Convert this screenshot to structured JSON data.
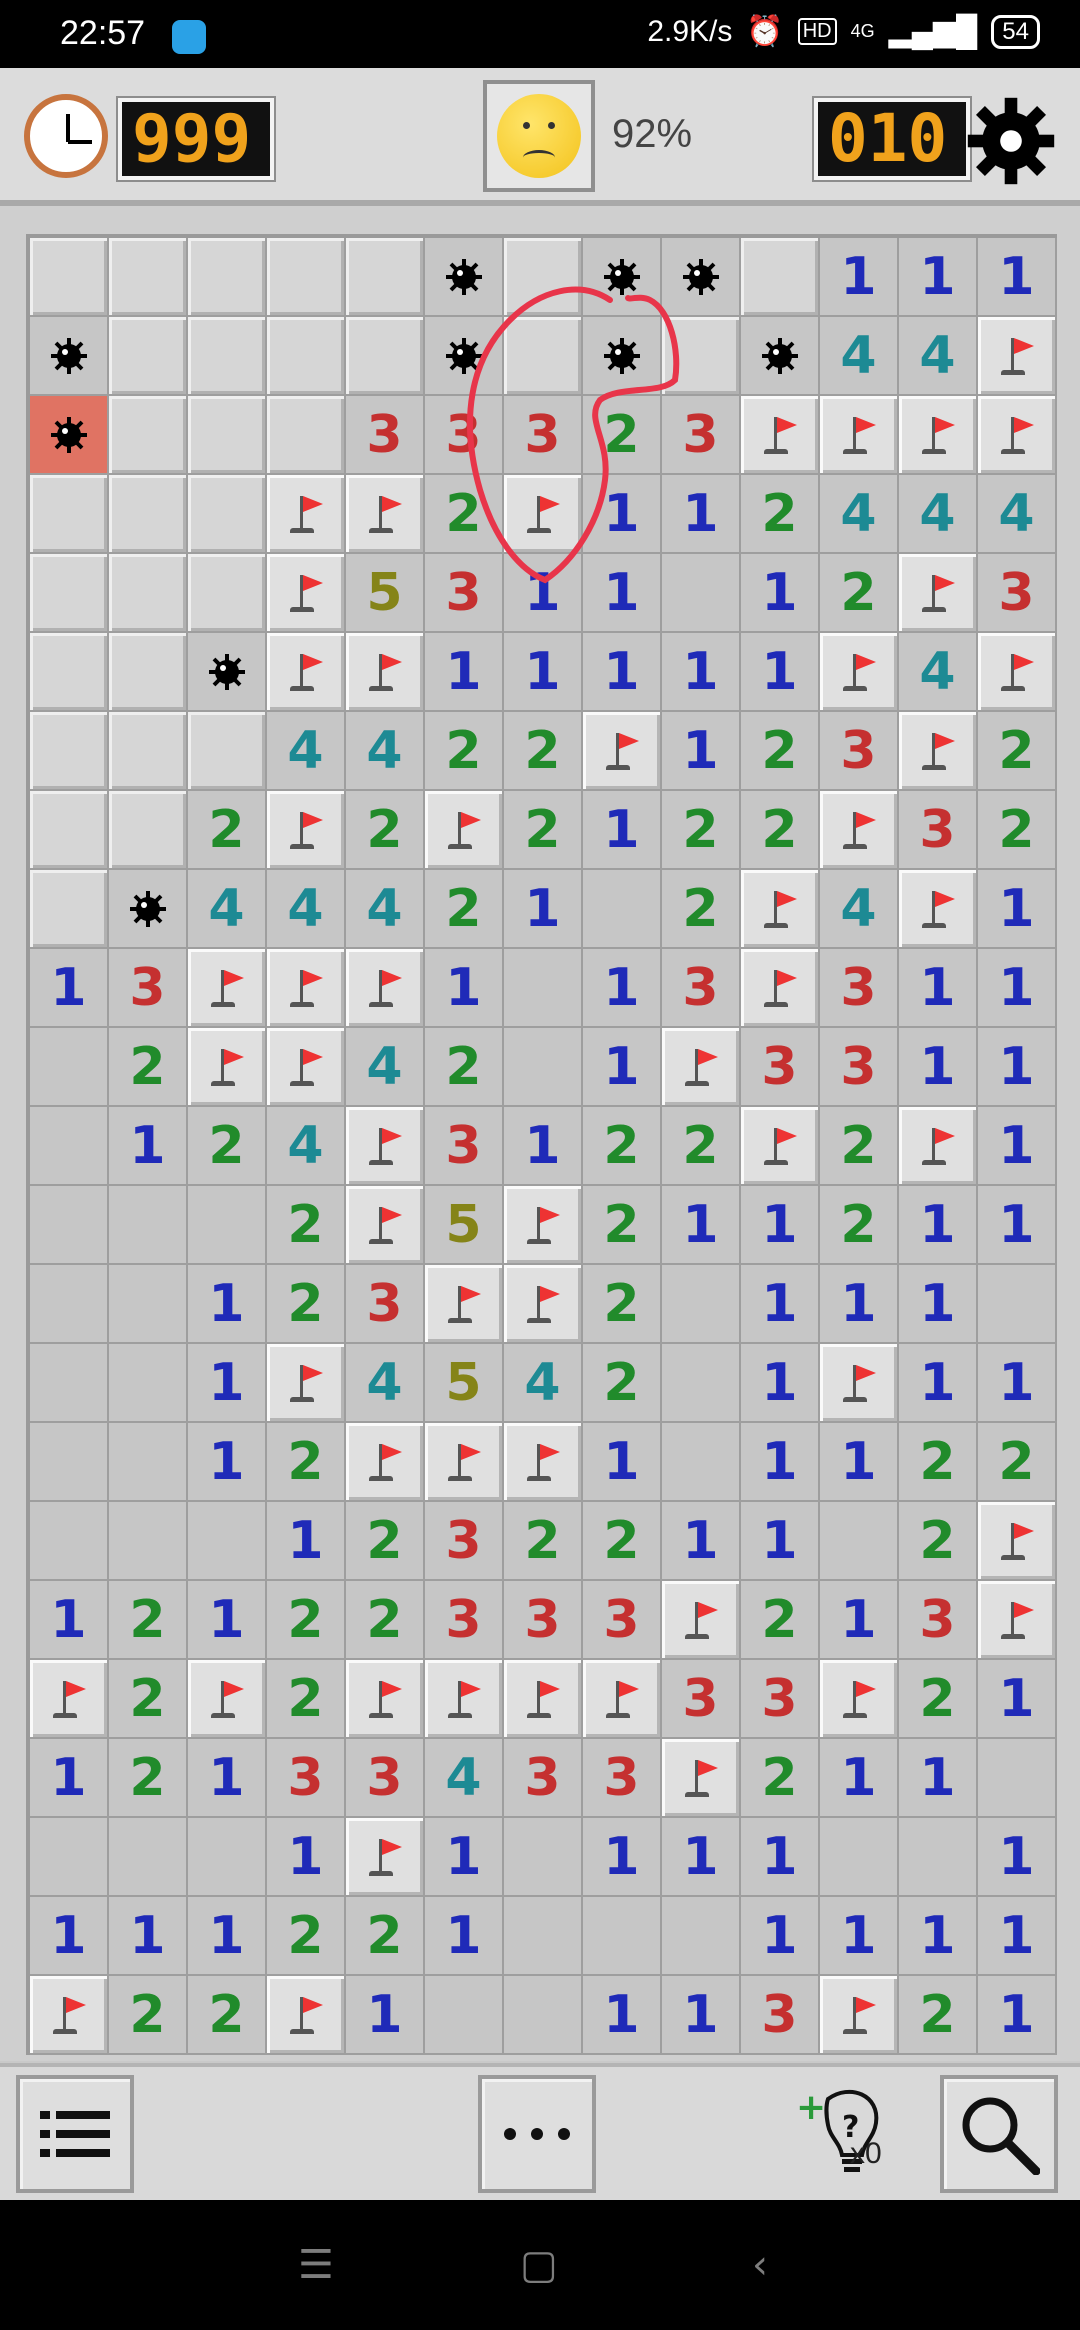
{
  "status": {
    "time": "22:57",
    "net": "2.9K/s",
    "hd": "HD",
    "signal": "4G",
    "battery": "54"
  },
  "header": {
    "timer": "999",
    "progress": "92%",
    "mines_left": "010"
  },
  "board": {
    "legend": "c=covered, f=flag, e=empty revealed, m=mine, b=exploded mine, digit=number",
    "rows": [
      [
        "c",
        "c",
        "c",
        "c",
        "c",
        "m",
        "c",
        "m",
        "m",
        "c",
        "1",
        "1",
        "1"
      ],
      [
        "m",
        "c",
        "c",
        "c",
        "c",
        "m",
        "c",
        "m",
        "c",
        "m",
        "4",
        "4",
        "f"
      ],
      [
        "b",
        "c",
        "c",
        "c",
        "3",
        "3",
        "3",
        "2",
        "3",
        "f",
        "f",
        "f",
        "f"
      ],
      [
        "c",
        "c",
        "c",
        "f",
        "f",
        "2",
        "f",
        "1",
        "1",
        "2",
        "4",
        "4",
        "4"
      ],
      [
        "c",
        "c",
        "c",
        "f",
        "5",
        "3",
        "1",
        "1",
        "e",
        "1",
        "2",
        "f",
        "3"
      ],
      [
        "c",
        "c",
        "m",
        "f",
        "f",
        "1",
        "1",
        "1",
        "1",
        "1",
        "f",
        "4",
        "f"
      ],
      [
        "c",
        "c",
        "c",
        "4",
        "4",
        "2",
        "2",
        "f",
        "1",
        "2",
        "3",
        "f",
        "2"
      ],
      [
        "c",
        "c",
        "2",
        "f",
        "2",
        "f",
        "2",
        "1",
        "2",
        "2",
        "f",
        "3",
        "2"
      ],
      [
        "c",
        "m",
        "4",
        "4",
        "4",
        "2",
        "1",
        "e",
        "2",
        "f",
        "4",
        "f",
        "1"
      ],
      [
        "1",
        "3",
        "f",
        "f",
        "f",
        "1",
        "e",
        "1",
        "3",
        "f",
        "3",
        "1",
        "1"
      ],
      [
        "e",
        "2",
        "f",
        "f",
        "4",
        "2",
        "e",
        "1",
        "f",
        "3",
        "3",
        "1",
        "1"
      ],
      [
        "e",
        "1",
        "2",
        "4",
        "f",
        "3",
        "1",
        "2",
        "2",
        "f",
        "2",
        "f",
        "1"
      ],
      [
        "e",
        "e",
        "e",
        "2",
        "f",
        "5",
        "f",
        "2",
        "1",
        "1",
        "2",
        "1",
        "1"
      ],
      [
        "e",
        "e",
        "1",
        "2",
        "3",
        "f",
        "f",
        "2",
        "e",
        "1",
        "1",
        "1",
        "e"
      ],
      [
        "e",
        "e",
        "1",
        "f",
        "4",
        "5",
        "4",
        "2",
        "e",
        "1",
        "f",
        "1",
        "1"
      ],
      [
        "e",
        "e",
        "1",
        "2",
        "f",
        "f",
        "f",
        "1",
        "e",
        "1",
        "1",
        "2",
        "2"
      ],
      [
        "e",
        "e",
        "e",
        "1",
        "2",
        "3",
        "2",
        "2",
        "1",
        "1",
        "e",
        "2",
        "f"
      ],
      [
        "1",
        "2",
        "1",
        "2",
        "2",
        "3",
        "3",
        "3",
        "f",
        "2",
        "1",
        "3",
        "f"
      ],
      [
        "f",
        "2",
        "f",
        "2",
        "f",
        "f",
        "f",
        "f",
        "3",
        "3",
        "f",
        "2",
        "1"
      ],
      [
        "1",
        "2",
        "1",
        "3",
        "3",
        "4",
        "3",
        "3",
        "f",
        "2",
        "1",
        "1",
        "e"
      ],
      [
        "e",
        "e",
        "e",
        "1",
        "f",
        "1",
        "e",
        "1",
        "1",
        "1",
        "e",
        "e",
        "1"
      ],
      [
        "1",
        "1",
        "1",
        "2",
        "2",
        "1",
        "e",
        "e",
        "e",
        "1",
        "1",
        "1",
        "1"
      ],
      [
        "f",
        "2",
        "2",
        "f",
        "1",
        "e",
        "e",
        "1",
        "1",
        "3",
        "f",
        "2",
        "1"
      ]
    ]
  },
  "toolbar": {
    "hint_count": "x0"
  },
  "colors": {
    "n1": "#1f2ab8",
    "n2": "#218b2b",
    "n3": "#c53030",
    "n4": "#1d8a94",
    "n5": "#858418",
    "lcd": "#f0a21c",
    "exploded": "#e07363",
    "scribble": "#e8354a"
  },
  "icons": {
    "clock": "clock-icon",
    "face": "sad-face-icon",
    "settings": "gear-icon",
    "menu": "list-icon",
    "more": "more-icon",
    "hint": "hint-bulb-icon",
    "search": "search-icon"
  }
}
